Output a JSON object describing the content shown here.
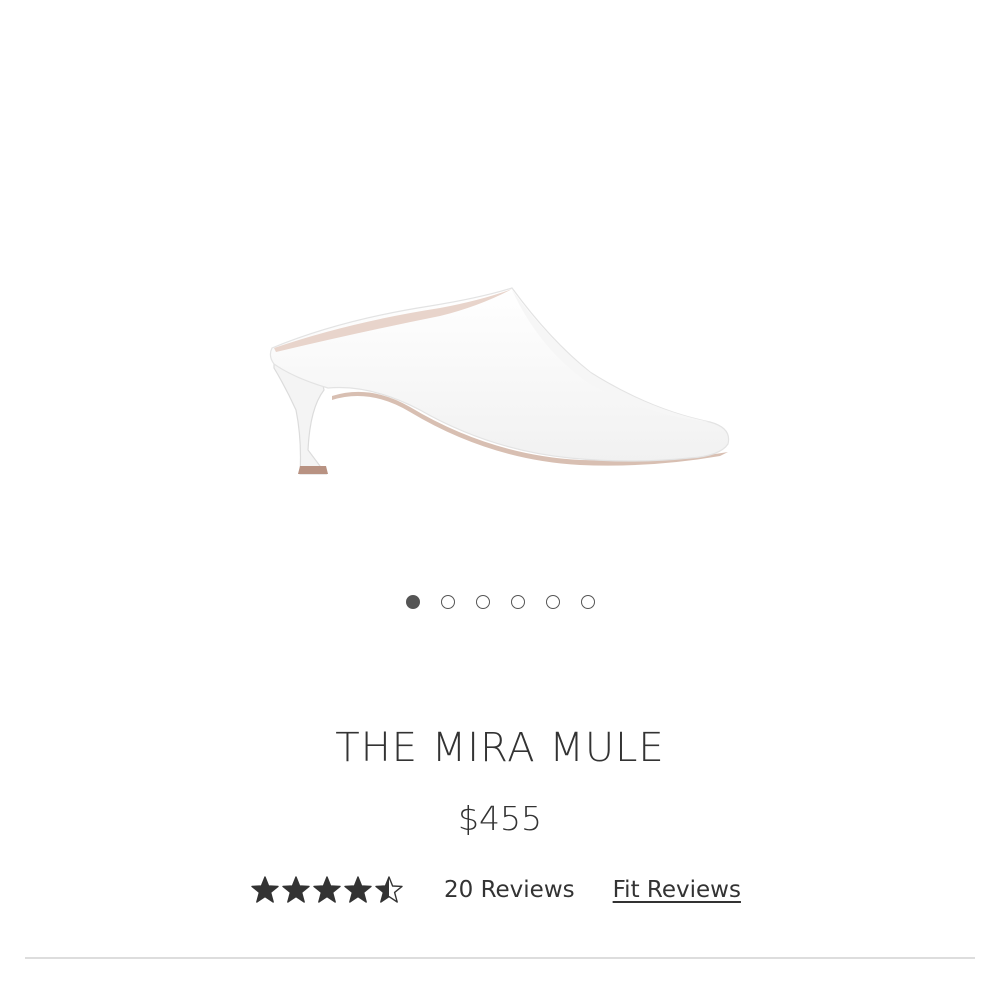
{
  "product": {
    "name": "THE MIRA MULE",
    "price": "$455",
    "image_icon": "white-pointed-mule-shoe",
    "colors": {
      "text": "#333333",
      "dot_active": "#555555",
      "divider": "#dddddd"
    }
  },
  "carousel": {
    "slide_count": 6,
    "active_index": 0
  },
  "rating": {
    "value": 4.5,
    "max": 5,
    "reviews_label": "20 Reviews",
    "fit_reviews_label": "Fit Reviews"
  }
}
